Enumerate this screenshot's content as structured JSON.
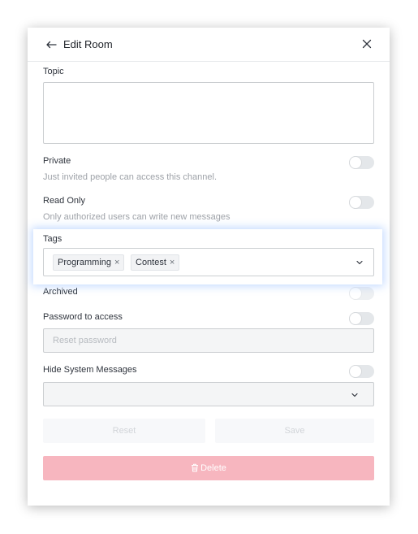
{
  "header": {
    "title": "Edit Room",
    "back_icon": "arrow-left-icon",
    "close_icon": "close-icon"
  },
  "topic": {
    "label": "Topic",
    "value": ""
  },
  "private": {
    "label": "Private",
    "hint": "Just invited people can access this channel.",
    "enabled": false
  },
  "read_only": {
    "label": "Read Only",
    "hint": "Only authorized users can write new messages",
    "enabled": false
  },
  "tags": {
    "label": "Tags",
    "items": [
      {
        "label": "Programming",
        "remove": "×"
      },
      {
        "label": "Contest",
        "remove": "×"
      }
    ]
  },
  "archived": {
    "label": "Archived",
    "enabled": false,
    "disabled": true
  },
  "password": {
    "label": "Password to access",
    "placeholder": "Reset password",
    "enabled": false
  },
  "hide_system_messages": {
    "label": "Hide System Messages",
    "enabled": false,
    "selected_value": ""
  },
  "actions": {
    "reset_label": "Reset",
    "save_label": "Save",
    "delete_label": "Delete",
    "delete_icon": "trash-icon"
  },
  "colors": {
    "delete_bg": "#f7b6bf",
    "border": "#cbced1",
    "hint_text": "#9ea2a8",
    "toggle_off": "#e4e7ea"
  }
}
